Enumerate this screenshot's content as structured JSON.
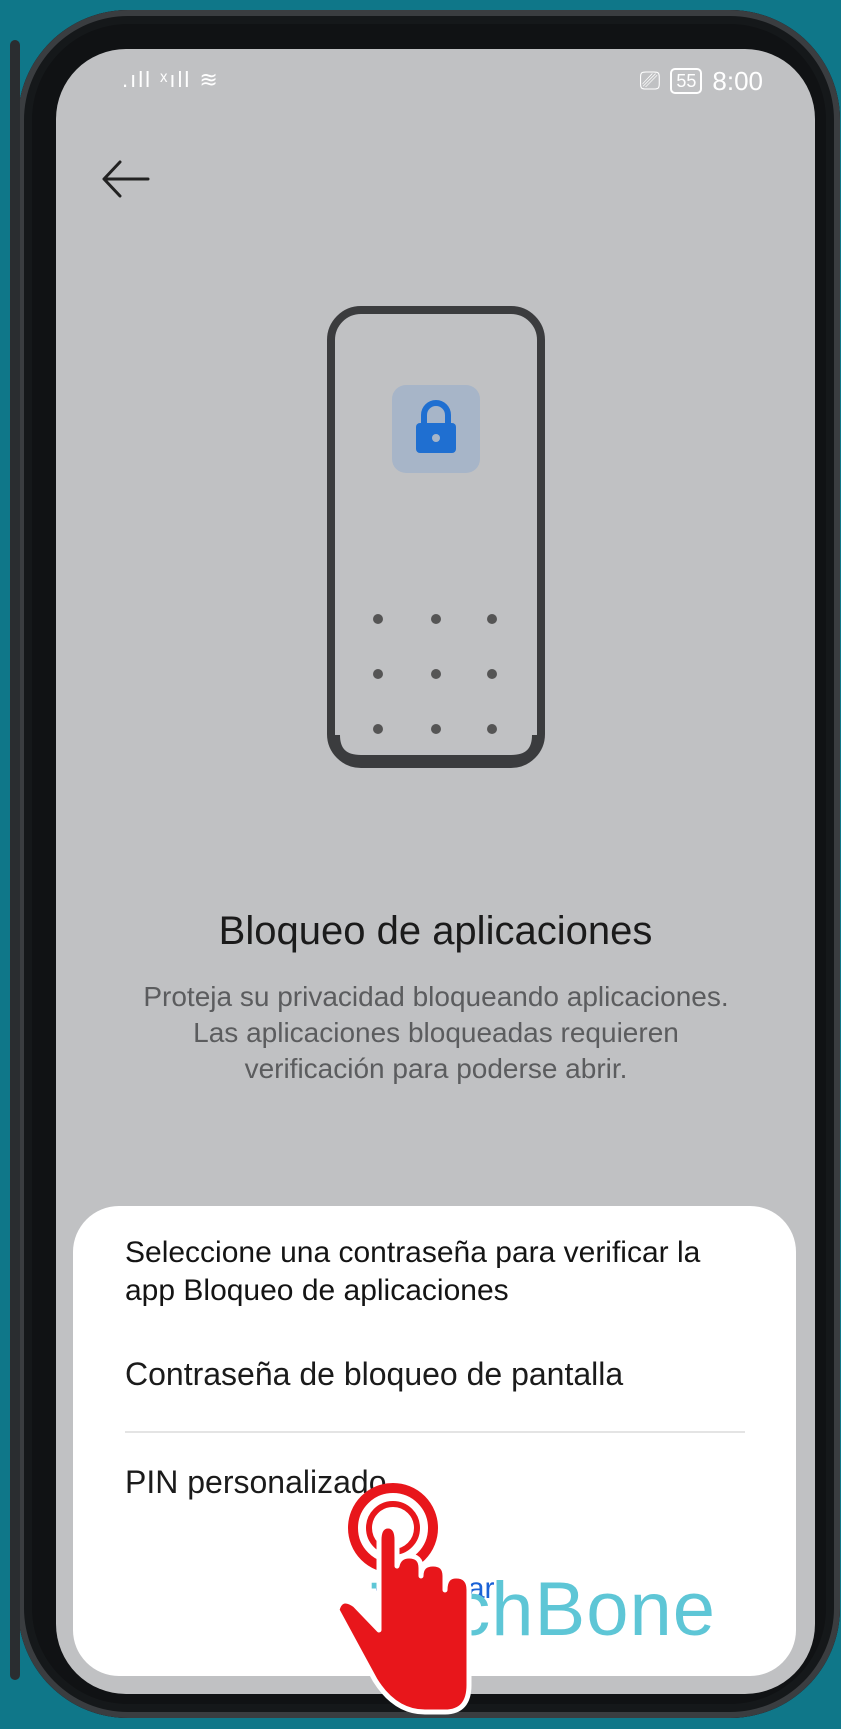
{
  "status_bar": {
    "signal": ".ıll ˣıll ≋",
    "battery": "55",
    "time": "8:00"
  },
  "header": {
    "back_icon": "arrow-left-icon"
  },
  "hero": {
    "title": "Bloqueo de aplicaciones",
    "description": "Proteja su privacidad bloqueando aplicaciones.\nLas aplicaciones bloqueadas requieren\nverificación para poderse abrir."
  },
  "sheet": {
    "title": "Seleccione una contraseña para verificar la app Bloqueo de aplicaciones",
    "options": [
      {
        "label": "Contraseña de bloqueo de pantalla"
      },
      {
        "label": "PIN personalizado"
      }
    ],
    "cancel_label": "Cancelar"
  },
  "watermark": "TechBone",
  "colors": {
    "background": "#0f7789",
    "screen": "#c0c1c3",
    "accent": "#1a62d6",
    "lock": "#1f6fd1",
    "hand": "#e8161b"
  }
}
